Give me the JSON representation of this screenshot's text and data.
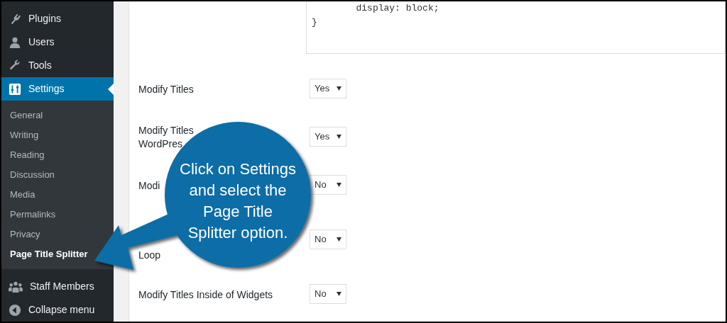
{
  "sidebar": {
    "items": [
      {
        "label": "Plugins",
        "selected": false
      },
      {
        "label": "Users",
        "selected": false
      },
      {
        "label": "Tools",
        "selected": false
      },
      {
        "label": "Settings",
        "selected": true,
        "children": [
          {
            "label": "General",
            "selected": false
          },
          {
            "label": "Writing",
            "selected": false
          },
          {
            "label": "Reading",
            "selected": false
          },
          {
            "label": "Discussion",
            "selected": false
          },
          {
            "label": "Media",
            "selected": false
          },
          {
            "label": "Permalinks",
            "selected": false
          },
          {
            "label": "Privacy",
            "selected": false
          },
          {
            "label": "Page Title Splitter",
            "selected": true
          }
        ]
      },
      {
        "label": "Staff Members",
        "selected": false
      },
      {
        "label": "Collapse menu",
        "selected": false
      }
    ]
  },
  "code_box": {
    "lines": [
      "        display: block;",
      "}"
    ]
  },
  "settings_rows": [
    {
      "label_lines": [
        "Modify Titles"
      ],
      "value": "Yes"
    },
    {
      "label_lines": [
        "Modify Titles",
        "WordPres"
      ],
      "value": "Yes"
    },
    {
      "label_lines": [
        "Modi"
      ],
      "value": "No"
    },
    {
      "label_lines": [
        "Loop"
      ],
      "value": "No"
    },
    {
      "label_lines": [
        "Modify Titles Inside of Widgets"
      ],
      "value": "No"
    }
  ],
  "callout": {
    "lines": [
      "Click on Settings",
      "and select the",
      "Page Title",
      "Splitter option."
    ]
  }
}
